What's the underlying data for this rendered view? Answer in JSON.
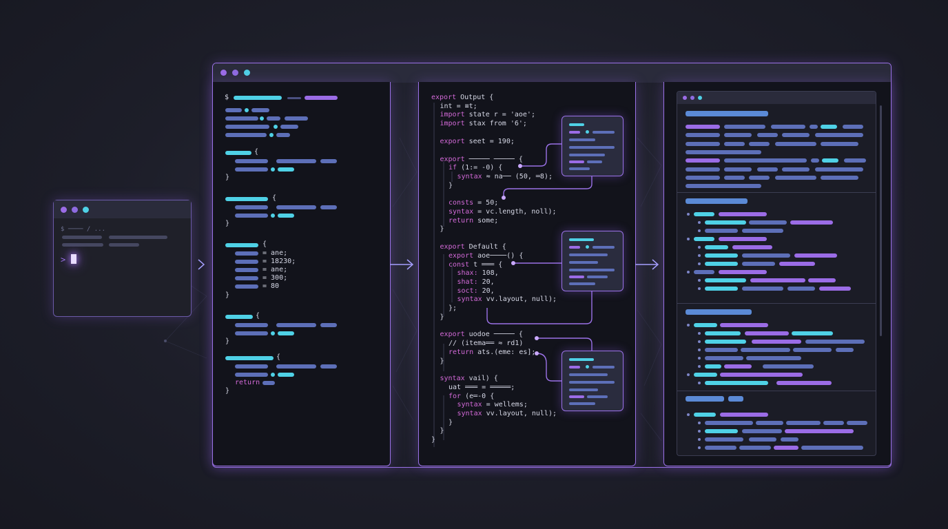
{
  "colors": {
    "accent_purple": "#9b72e8",
    "accent_cyan": "#4fd1e6",
    "background": "#1d1e29"
  },
  "terminal": {
    "prompt_symbol": "$",
    "prompt_line": "$ ──── / ...",
    "cursor_prompt": ">"
  },
  "left_code": {
    "prompt": "$",
    "return_keyword": "return",
    "numbers": [
      "= ane;",
      "= 18230;",
      "= ane;",
      "= 300;",
      "= 80"
    ]
  },
  "middle_code": {
    "lines": [
      {
        "k": "export",
        "t": " Output {",
        "i": 0
      },
      {
        "k": "",
        "t": "int = ≡t;",
        "i": 1
      },
      {
        "k": "import",
        "t": " state r = 'aoe';",
        "i": 1
      },
      {
        "k": "import",
        "t": " stax from '6';",
        "i": 1
      },
      {
        "k": "",
        "t": "",
        "i": 0
      },
      {
        "k": "export",
        "t": " seet = 190;",
        "i": 1
      },
      {
        "k": "",
        "t": "",
        "i": 0
      },
      {
        "k": "export",
        "t": " ───── ───── {",
        "i": 1
      },
      {
        "k": "if",
        "t": " (1:= -0) {",
        "i": 2
      },
      {
        "k": "syntax",
        "t": " ≈ na── (50, ═8);",
        "i": 3
      },
      {
        "k": "",
        "t": "}",
        "i": 2
      },
      {
        "k": "",
        "t": "",
        "i": 0
      },
      {
        "k": "consts",
        "t": " = 50;",
        "i": 2
      },
      {
        "k": "syntax",
        "t": " = vc.length, noll);",
        "i": 2
      },
      {
        "k": "return",
        "t": " some;",
        "i": 2
      },
      {
        "k": "",
        "t": "}",
        "i": 1
      },
      {
        "k": "",
        "t": "",
        "i": 0
      },
      {
        "k": "export",
        "t": " Default {",
        "i": 1
      },
      {
        "k": "export",
        "t": " aoe────() {",
        "i": 2
      },
      {
        "k": "const",
        "t": " t ═══ {",
        "i": 2
      },
      {
        "k": "shax:",
        "t": " 108,",
        "i": 3
      },
      {
        "k": "shat:",
        "t": " 20,",
        "i": 3
      },
      {
        "k": "soct:",
        "t": " 20,",
        "i": 3
      },
      {
        "k": "syntax",
        "t": " vv.layout, null);",
        "i": 3
      },
      {
        "k": "",
        "t": "};",
        "i": 2
      },
      {
        "k": "",
        "t": "}",
        "i": 1
      },
      {
        "k": "",
        "t": "",
        "i": 0
      },
      {
        "k": "export",
        "t": " uodoe ───── {",
        "i": 1
      },
      {
        "k": "",
        "t": "// (itema══ ≈ rd1)",
        "i": 2
      },
      {
        "k": "return",
        "t": " ats.(eme: es];",
        "i": 2
      },
      {
        "k": "",
        "t": "}",
        "i": 1
      },
      {
        "k": "",
        "t": "",
        "i": 0
      },
      {
        "k": "syntax",
        "t": " vail) {",
        "i": 1
      },
      {
        "k": "",
        "t": "uat ═══ = ═════;",
        "i": 2
      },
      {
        "k": "for",
        "t": " (e═-0 {",
        "i": 2
      },
      {
        "k": "syntax",
        "t": " = wellems;",
        "i": 3
      },
      {
        "k": "syntax",
        "t": " vv.layout, null);",
        "i": 3
      },
      {
        "k": "",
        "t": "}",
        "i": 2
      },
      {
        "k": "",
        "t": "}",
        "i": 1
      },
      {
        "k": "",
        "t": "}",
        "i": 0
      }
    ]
  },
  "icons": [
    "window-dot-icon",
    "arrow-right-icon",
    "terminal-cursor-icon",
    "connector-dot-icon"
  ]
}
